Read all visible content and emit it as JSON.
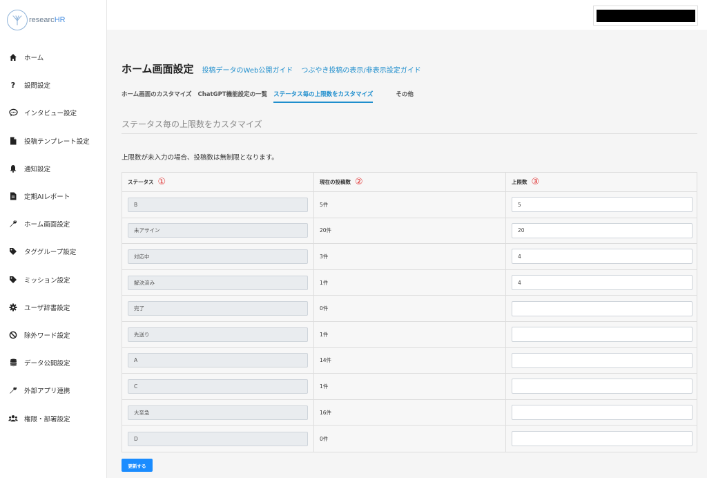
{
  "logo": {
    "prefix": "researc",
    "suffix": "HR"
  },
  "sidebar": {
    "items": [
      {
        "label": "ホーム",
        "icon": "home-icon"
      },
      {
        "label": "設問設定",
        "icon": "question-icon"
      },
      {
        "label": "インタビュー設定",
        "icon": "chat-icon"
      },
      {
        "label": "投稿テンプレート設定",
        "icon": "file-icon"
      },
      {
        "label": "通知設定",
        "icon": "bell-icon"
      },
      {
        "label": "定期AIレポート",
        "icon": "report-icon"
      },
      {
        "label": "ホーム画面設定",
        "icon": "wrench-icon"
      },
      {
        "label": "タググループ設定",
        "icon": "tag-icon"
      },
      {
        "label": "ミッション設定",
        "icon": "tag-icon"
      },
      {
        "label": "ユーザ辞書設定",
        "icon": "gear-icon"
      },
      {
        "label": "除外ワード設定",
        "icon": "ban-icon"
      },
      {
        "label": "データ公開設定",
        "icon": "database-icon"
      },
      {
        "label": "外部アプリ連携",
        "icon": "wrench-icon"
      },
      {
        "label": "権限・部署設定",
        "icon": "users-icon"
      }
    ]
  },
  "header": {
    "title": "ホーム画面設定",
    "links": [
      "投稿データのWeb公開ガイド",
      "つぶやき投稿の表示/非表示設定ガイド"
    ]
  },
  "tabs": [
    {
      "label": "ホーム画面のカスタマイズ",
      "active": false
    },
    {
      "label": "ChatGPT機能設定の一覧",
      "active": false
    },
    {
      "label": "ステータス毎の上限数をカスタマイズ",
      "active": true
    },
    {
      "label": "その他",
      "active": false
    }
  ],
  "section_title": "ステータス毎の上限数をカスタマイズ",
  "note": "上限数が未入力の場合、投稿数は無制限となります。",
  "table": {
    "headers": [
      {
        "label": "ステータス",
        "marker": "①"
      },
      {
        "label": "現在の投稿数",
        "marker": "②"
      },
      {
        "label": "上限数",
        "marker": "③"
      }
    ],
    "rows": [
      {
        "status": "B",
        "count": "5件",
        "limit": "5"
      },
      {
        "status": "未アサイン",
        "count": "20件",
        "limit": "20"
      },
      {
        "status": "対応中",
        "count": "3件",
        "limit": "4"
      },
      {
        "status": "解決済み",
        "count": "1件",
        "limit": "4"
      },
      {
        "status": "完了",
        "count": "0件",
        "limit": ""
      },
      {
        "status": "先送り",
        "count": "1件",
        "limit": ""
      },
      {
        "status": "A",
        "count": "14件",
        "limit": ""
      },
      {
        "status": "C",
        "count": "1件",
        "limit": ""
      },
      {
        "status": "大至急",
        "count": "16件",
        "limit": ""
      },
      {
        "status": "D",
        "count": "0件",
        "limit": ""
      }
    ]
  },
  "update_button": "更新する",
  "colors": {
    "accent": "#1f8ecd",
    "button": "#1a8cff",
    "marker": "#e03030"
  }
}
